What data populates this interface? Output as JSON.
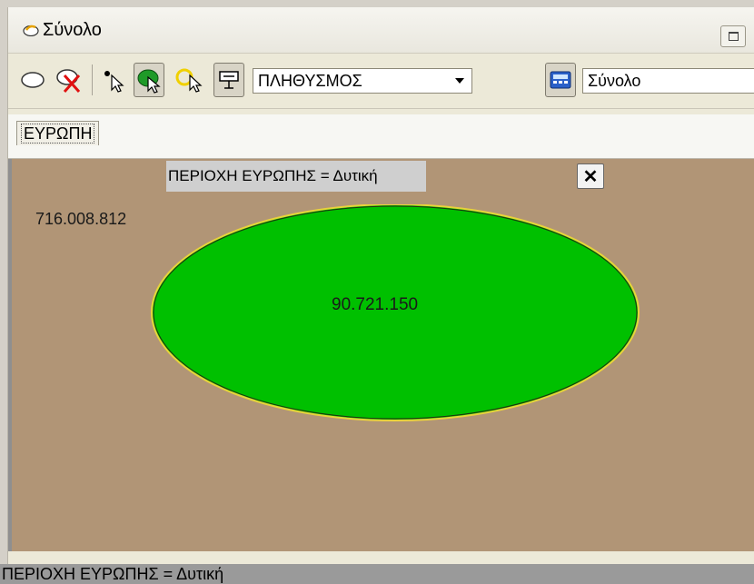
{
  "window": {
    "title": "Σύνολο"
  },
  "toolbar": {
    "buttons": [
      {
        "name": "ellipse-tool-icon"
      },
      {
        "name": "delete-set-icon"
      },
      {
        "name": "point-select-icon"
      },
      {
        "name": "region-select-icon"
      },
      {
        "name": "highlight-select-icon"
      },
      {
        "name": "presentation-icon"
      }
    ],
    "variable_select": "ΠΛΗΘΥΣΜΟΣ",
    "calculator_icon": "calculator-icon",
    "aggregate_select": "Σύνολο"
  },
  "tabs": [
    {
      "label": "ΕΥΡΩΠΗ"
    }
  ],
  "canvas": {
    "background": "#b19576",
    "filter_label": "ΠΕΡΙΟΧΗ ΕΥΡΩΠΗΣ = Δυτική",
    "close_glyph": "✕",
    "total_value": "716.008.812",
    "set_value": "90.721.150",
    "set_fill": "#00c000"
  },
  "statusbar": {
    "text": "ΠΕΡΙΟΧΗ ΕΥΡΩΠΗΣ = Δυτική"
  }
}
